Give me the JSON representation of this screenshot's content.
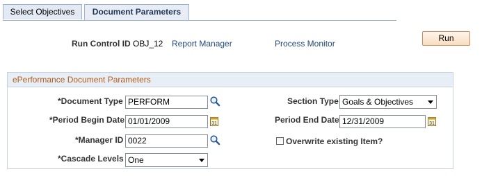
{
  "tabs": [
    {
      "label": "Select Objectives",
      "active": false
    },
    {
      "label": "Document Parameters",
      "active": true
    }
  ],
  "run_control": {
    "label": "Run Control ID",
    "value": "OBJ_12",
    "report_manager_link": "Report Manager",
    "process_monitor_link": "Process Monitor"
  },
  "run_button": "Run",
  "group": {
    "title": "ePerformance Document Parameters",
    "document_type": {
      "label": "*Document Type",
      "value": "PERFORM",
      "icon": "lookup-icon"
    },
    "section_type": {
      "label": "Section Type",
      "value": "Goals & Objectives"
    },
    "period_begin_date": {
      "label": "*Period Begin Date",
      "value": "01/01/2009",
      "icon": "calendar-icon"
    },
    "period_end_date": {
      "label": "Period End Date",
      "value": "12/31/2009",
      "icon": "calendar-icon"
    },
    "manager_id": {
      "label": "*Manager ID",
      "value": "0022",
      "icon": "lookup-icon"
    },
    "overwrite": {
      "label": "Overwrite existing Item?",
      "checked": false
    },
    "cascade_levels": {
      "label": "*Cascade Levels",
      "value": "One"
    }
  },
  "colors": {
    "group_title": "#b05a17",
    "link": "#20487e",
    "tab_border": "#9db2cc",
    "run_button_border": "#c68e5f"
  }
}
